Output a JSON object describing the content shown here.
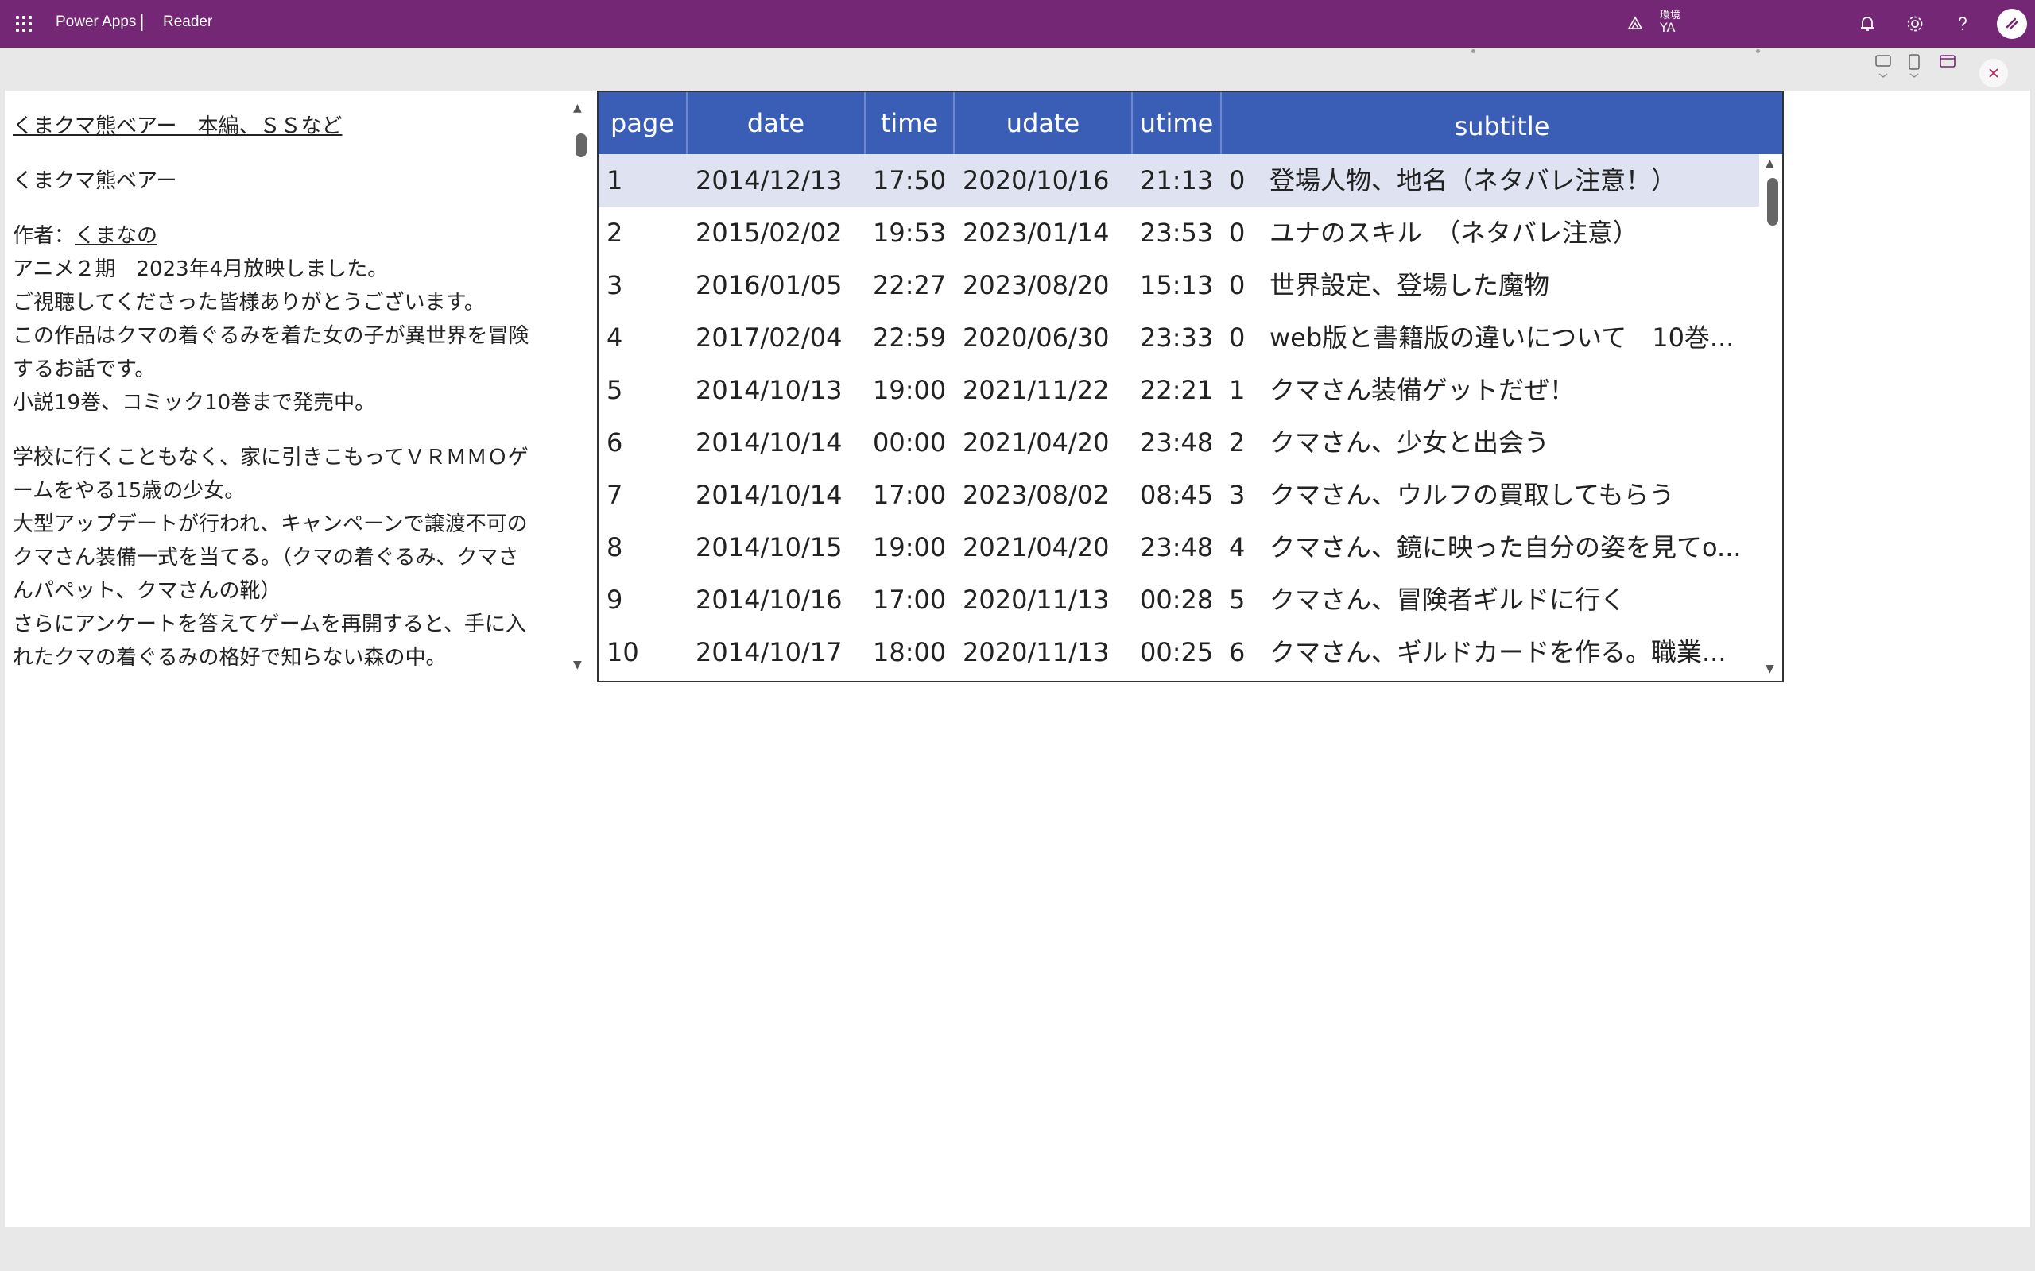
{
  "topbar": {
    "app_name": "Power Apps",
    "separator": "|",
    "page_name": "Reader",
    "environment_label": "環境",
    "environment_value": "YA",
    "icons": [
      "waffle-icon",
      "environment-icon",
      "bell-icon",
      "gear-icon",
      "help-icon",
      "avatar"
    ],
    "brand_color": "#742774"
  },
  "ribbon": {
    "icons": [
      "comment-icon",
      "phone-icon",
      "app-icon",
      "close-icon"
    ]
  },
  "text_panel": {
    "title_link": "くまクマ熊ベアー　本編、ＳＳなど",
    "subtitle": "くまクマ熊ベアー",
    "author_label": "作者：",
    "author_link": "くまなの",
    "lines_a": [
      "アニメ２期　2023年4月放映しました。",
      "ご視聴してくださった皆様ありがとうございます。",
      "この作品はクマの着ぐるみを着た女の子が異世界を冒険",
      "するお話です。",
      "小説19巻、コミック10巻まで発売中。"
    ],
    "lines_b": [
      "学校に行くこともなく、家に引きこもってＶＲＭＭＯゲ",
      "ームをやる15歳の少女。",
      "大型アップデートが行われ、キャンペーンで譲渡不可の",
      "クマさん装備一式を当てる。（クマの着ぐるみ、クマさ",
      "んパペット、クマさんの靴）",
      "さらにアンケートを答えてゲームを再開すると、手に入",
      "れたクマの着ぐるみの格好で知らない森の中。"
    ]
  },
  "gallery": {
    "header_color": "#3a5eb6",
    "selected_color": "#dfe3f1",
    "columns": [
      "page",
      "date",
      "time",
      "udate",
      "utime",
      "subtitle"
    ],
    "rows": [
      {
        "page": "1",
        "date": "2014/12/13",
        "time": "17:50",
        "udate": "2020/10/16",
        "utime": "21:13",
        "num": "0",
        "subtitle": "登場人物、地名（ネタバレ注意！）"
      },
      {
        "page": "2",
        "date": "2015/02/02",
        "time": "19:53",
        "udate": "2023/01/14",
        "utime": "23:53",
        "num": "0",
        "subtitle": "ユナのスキル　（ネタバレ注意）"
      },
      {
        "page": "3",
        "date": "2016/01/05",
        "time": "22:27",
        "udate": "2023/08/20",
        "utime": "15:13",
        "num": "0",
        "subtitle": "世界設定、登場した魔物"
      },
      {
        "page": "4",
        "date": "2017/02/04",
        "time": "22:59",
        "udate": "2020/06/30",
        "utime": "23:33",
        "num": "0",
        "subtitle": "web版と書籍版の違いについて　10巻..."
      },
      {
        "page": "5",
        "date": "2014/10/13",
        "time": "19:00",
        "udate": "2021/11/22",
        "utime": "22:21",
        "num": "1",
        "subtitle": "クマさん装備ゲットだぜ！"
      },
      {
        "page": "6",
        "date": "2014/10/14",
        "time": "00:00",
        "udate": "2021/04/20",
        "utime": "23:48",
        "num": "2",
        "subtitle": "クマさん、少女と出会う"
      },
      {
        "page": "7",
        "date": "2014/10/14",
        "time": "17:00",
        "udate": "2023/08/02",
        "utime": "08:45",
        "num": "3",
        "subtitle": "クマさん、ウルフの買取してもらう"
      },
      {
        "page": "8",
        "date": "2014/10/15",
        "time": "19:00",
        "udate": "2021/04/20",
        "utime": "23:48",
        "num": "4",
        "subtitle": "クマさん、鏡に映った自分の姿を見てo..."
      },
      {
        "page": "9",
        "date": "2014/10/16",
        "time": "17:00",
        "udate": "2020/11/13",
        "utime": "00:28",
        "num": "5",
        "subtitle": "クマさん、冒険者ギルドに行く"
      },
      {
        "page": "10",
        "date": "2014/10/17",
        "time": "18:00",
        "udate": "2020/11/13",
        "utime": "00:25",
        "num": "6",
        "subtitle": "クマさん、ギルドカードを作る。職業..."
      }
    ]
  }
}
